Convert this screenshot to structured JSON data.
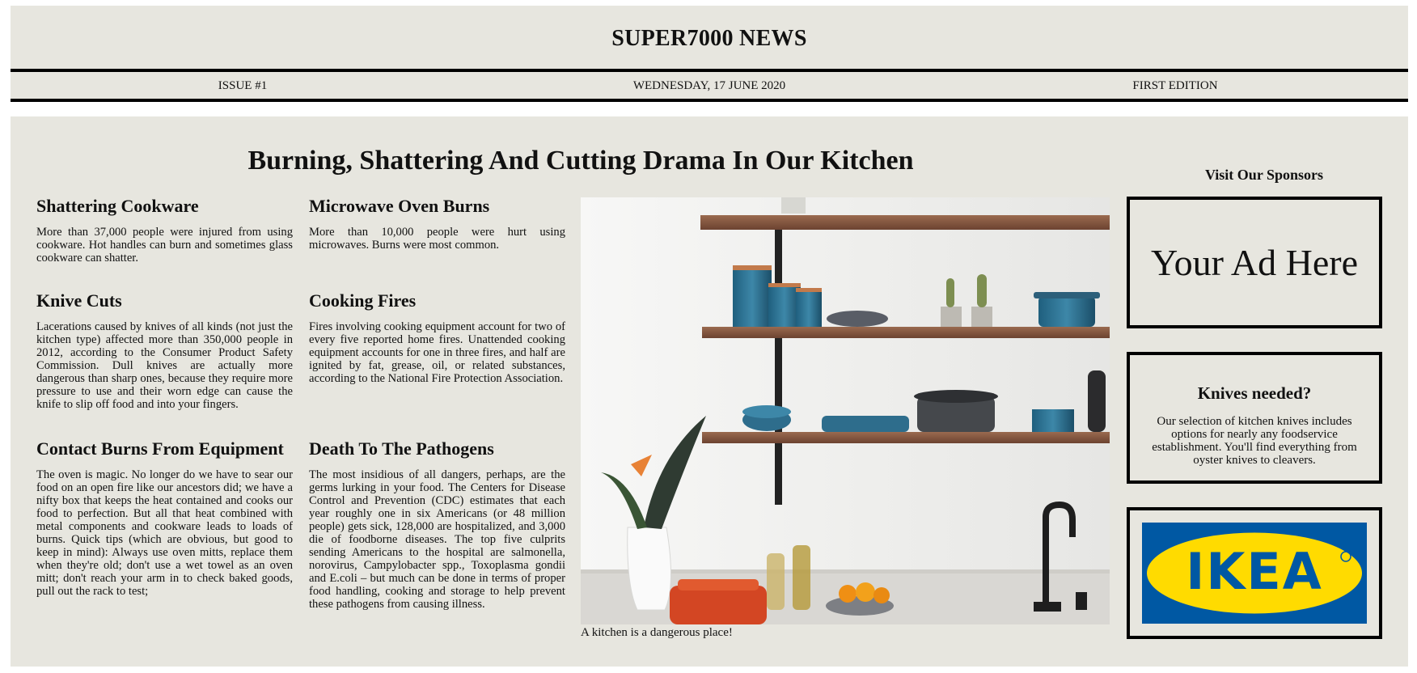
{
  "masthead": {
    "title": "SUPER7000 NEWS"
  },
  "infobar": {
    "issue": "ISSUE #1",
    "date": "WEDNESDAY, 17 JUNE 2020",
    "edition": "FIRST EDITION"
  },
  "main": {
    "headline": "Burning, Shattering And Cutting Drama In Our Kitchen",
    "articles": [
      {
        "title": "Shattering Cookware",
        "body": "More than 37,000 people were injured from using cookware. Hot handles can burn and sometimes glass cookware can shatter."
      },
      {
        "title": "Microwave Oven Burns",
        "body": "More than 10,000 people were hurt using microwaves. Burns were most common."
      },
      {
        "title": "Knive Cuts",
        "body": "Lacerations caused by knives of all kinds (not just the kitchen type) affected more than 350,000 people in 2012, according to the Consumer Product Safety Commission. Dull knives are actually more dangerous than sharp ones, because they require more pressure to use and their worn edge can cause the knife to slip off food and into your fingers."
      },
      {
        "title": "Cooking Fires",
        "body": "Fires involving cooking equipment account for two of every five reported home fires. Unattended cooking equipment accounts for one in three fires, and half are ignited by fat, grease, oil, or related substances, according to the National Fire Protection Association."
      },
      {
        "title": "Contact Burns From Equipment",
        "body": "The oven is magic. No longer do we have to sear our food on an open fire like our ancestors did; we have a nifty box that keeps the heat contained and cooks our food to perfection. But all that heat combined with metal components and cookware leads to loads of burns. Quick tips (which are obvious, but good to keep in mind): Always use oven mitts, replace them when they're old; don't use a wet towel as an oven mitt; don't reach your arm in to check baked goods, pull out the rack to test;"
      },
      {
        "title": "Death To The Pathogens",
        "body": "The most insidious of all dangers, perhaps, are the germs lurking in your food. The Centers for Disease Control and Prevention (CDC) estimates that each year roughly one in six Americans (or 48 million people) gets sick, 128,000 are hospitalized, and 3,000 die of foodborne diseases. The top five culprits sending Americans to the hospital are salmonella, norovirus, Campylobacter spp., Toxoplasma gondii and E.coli – but much can be done in terms of proper food handling, cooking and storage to help prevent these pathogens from causing illness."
      }
    ],
    "photo_caption": "A kitchen is a dangerous place!"
  },
  "sidebar": {
    "title": "Visit Our Sponsors",
    "ad_placeholder": "Your Ad Here",
    "knives_ad": {
      "title": "Knives needed?",
      "body": "Our selection of kitchen knives includes options for nearly any foodservice establishment. You'll find everything from oyster knives to cleavers."
    },
    "logo_ad": {
      "brand": "IKEA",
      "blue": "#0058a3",
      "yellow": "#ffdb00"
    }
  }
}
